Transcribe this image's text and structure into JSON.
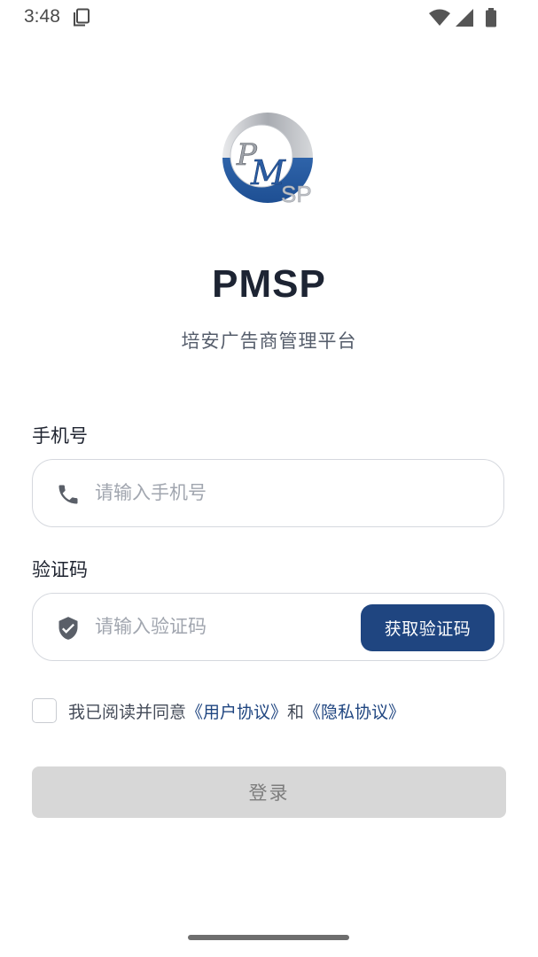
{
  "status_bar": {
    "time": "3:48",
    "icons": [
      "screenshot-icon",
      "wifi-icon",
      "signal-icon",
      "battery-icon"
    ]
  },
  "logo": {
    "letters": "PMSP",
    "colors": {
      "blue": "#2c62a8",
      "silver": "#b9bcc2"
    }
  },
  "app": {
    "title": "PMSP",
    "subtitle": "培安广告商管理平台"
  },
  "form": {
    "phone": {
      "label": "手机号",
      "placeholder": "请输入手机号",
      "value": "",
      "icon": "phone-icon"
    },
    "code": {
      "label": "验证码",
      "placeholder": "请输入验证码",
      "value": "",
      "icon": "shield-check-icon",
      "button_label": "获取验证码"
    },
    "agreement": {
      "checked": false,
      "prefix": "我已阅读并同意",
      "user_agreement": "《用户协议》",
      "conjunction": "和",
      "privacy_policy": "《隐私协议》"
    },
    "login_label": "登录"
  },
  "colors": {
    "primary": "#1f4580",
    "disabled_button": "#d7d7d7",
    "border": "#d5d8de",
    "placeholder": "#a1a6af"
  }
}
